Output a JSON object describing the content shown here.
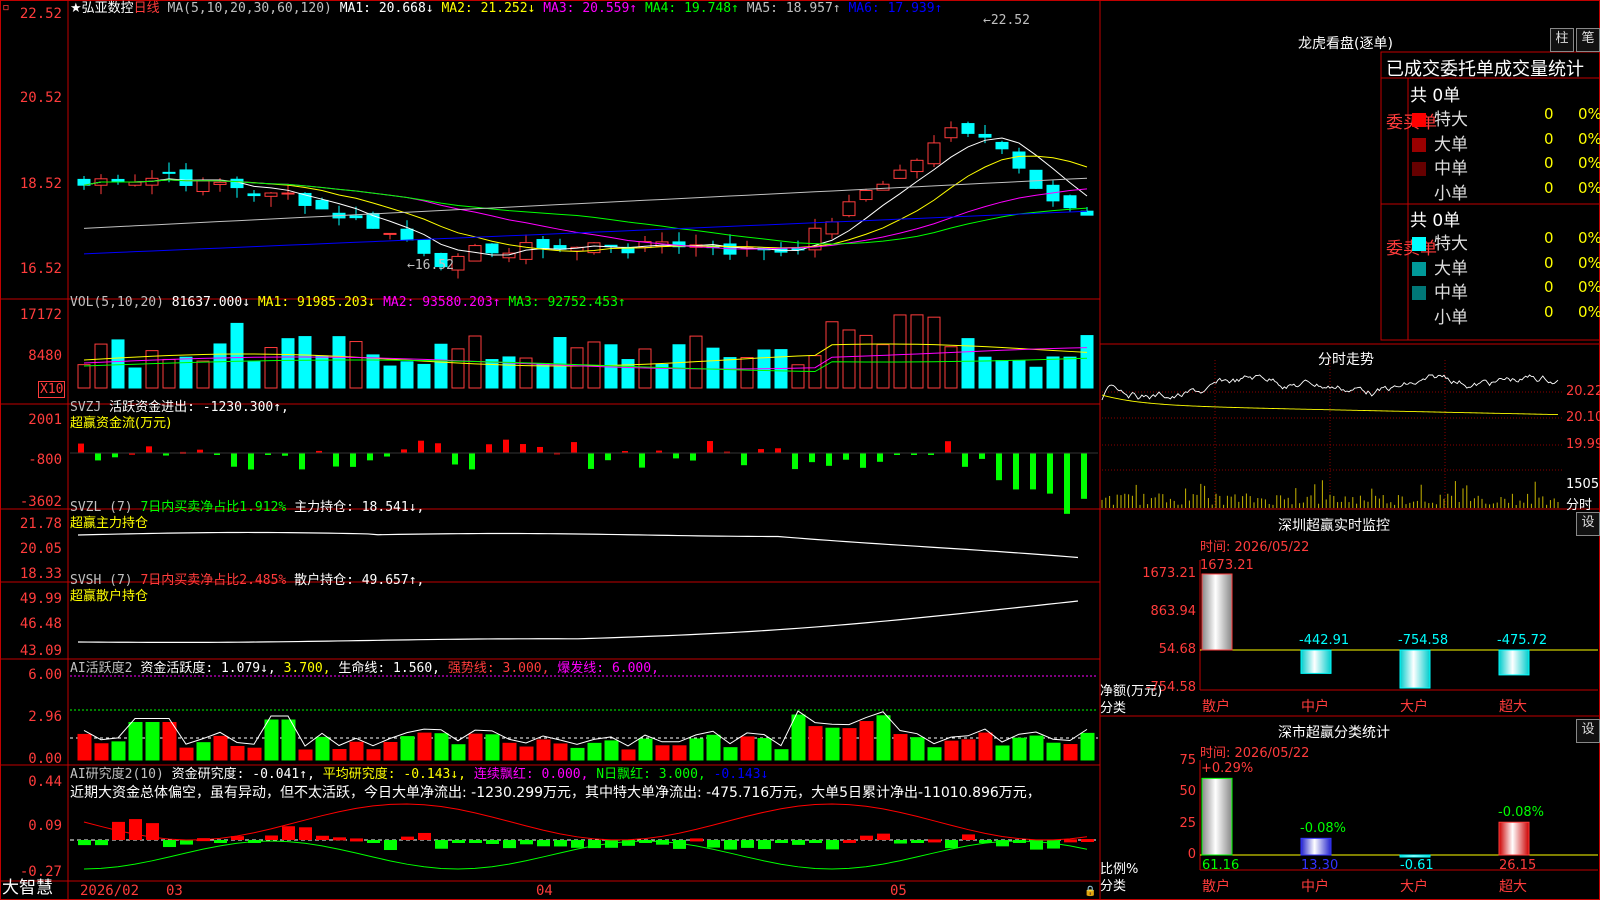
{
  "app": {
    "name": "大智慧"
  },
  "stock": {
    "name": "★弘亚数控",
    "period": "日线"
  },
  "colors": {
    "up": "#ff3c3c",
    "down": "#00ffff",
    "bg": "#000000",
    "frame": "#c00000"
  },
  "main_chart": {
    "ma_text": "MA(5,10,20,30,60,120)",
    "ma": [
      {
        "label": "MA1: 20.668↓",
        "color": "#ffffff"
      },
      {
        "label": "MA2: 21.252↓",
        "color": "#ffff00"
      },
      {
        "label": "MA3: 20.559↑",
        "color": "#ff00ff"
      },
      {
        "label": "MA4: 19.748↑",
        "color": "#00ff00"
      },
      {
        "label": "MA5: 18.957↑",
        "color": "#c0c0c0"
      },
      {
        "label": "MA6: 17.939↑",
        "color": "#0000ff"
      }
    ],
    "y_ticks": [
      "22.52",
      "20.52",
      "18.52",
      "16.52"
    ],
    "high_marker": "22.52",
    "low_marker": "16.52"
  },
  "vol_panel": {
    "title": "VOL(5,10,20)",
    "value": "81637.000↓",
    "ma": [
      {
        "label": "MA1: 91985.203↓",
        "color": "#ffff00"
      },
      {
        "label": "MA2: 93580.203↑",
        "color": "#ff00ff"
      },
      {
        "label": "MA3: 92752.453↑",
        "color": "#00ff00"
      }
    ],
    "y_ticks": [
      "17172",
      "8480"
    ],
    "unit": "X10"
  },
  "svzj_panel": {
    "title": "SVZJ",
    "line1": "活跃资金进出: -1230.300↑,",
    "line2": "超赢资金流(万元)",
    "y_ticks": [
      "2001",
      "-800",
      "-3602"
    ]
  },
  "svzl_panel": {
    "title": "SVZL (7)",
    "line1a": "7日内买卖净占比1.912%",
    "line1b": "主力持仓: 18.541↓,",
    "line2": "超赢主力持仓",
    "y_ticks": [
      "21.78",
      "20.05",
      "18.33"
    ]
  },
  "svsh_panel": {
    "title": "SVSH (7)",
    "line1a": "7日内买卖净占比2.485%",
    "line1b": "散户持仓: 49.657↑,",
    "line2": "超赢散户持仓",
    "y_ticks": [
      "49.99",
      "46.48",
      "43.09"
    ]
  },
  "ai_activity_panel": {
    "title": "AI活跃度2",
    "t1": "资金活跃度: 1.079↓,",
    "t2": "3.700,",
    "t3": "生命线: 1.560,",
    "t4": "强势线: 3.000,",
    "t5": "爆发线: 6.000,",
    "y_ticks": [
      "6.00",
      "2.96",
      "0.00"
    ]
  },
  "ai_research_panel": {
    "title": "AI研究度2(10)",
    "t1": "资金研究度: -0.041↑,",
    "t2": "平均研究度: -0.143↓,",
    "t3": "连续飘红: 0.000,",
    "t4": "N日飘红: 3.000,",
    "t5": "-0.143↓",
    "comment": "近期大资金总体偏空，虽有异动，但不太活跃，今日大单净流出: -1230.299万元，其中特大单净流出: -475.716万元，大单5日累计净出-11010.896万元，",
    "y_ticks": [
      "0.44",
      "0.09",
      "-0.27"
    ]
  },
  "x_axis": {
    "labels": [
      "2026/02",
      "03",
      "04",
      "05"
    ]
  },
  "right_panel": {
    "tiger": {
      "title": "龙虎看盘(逐单)",
      "btn1": "柱",
      "btn2": "笔",
      "header": "已成交委托单成交量统计",
      "buy_label": "委买单",
      "buy_total": "共 0单",
      "sell_label": "委卖单",
      "sell_total": "共 0单",
      "buy_rows": [
        {
          "name": "特大",
          "count": "0",
          "pct": "0%",
          "color": "#ff0000"
        },
        {
          "name": "大单",
          "count": "0",
          "pct": "0%",
          "color": "#990000"
        },
        {
          "name": "中单",
          "count": "0",
          "pct": "0%",
          "color": "#660000"
        },
        {
          "name": "小单",
          "count": "0",
          "pct": "0%",
          "color": "#000000"
        }
      ],
      "sell_rows": [
        {
          "name": "特大",
          "count": "0",
          "pct": "0%",
          "color": "#00ffff"
        },
        {
          "name": "大单",
          "count": "0",
          "pct": "0%",
          "color": "#009999"
        },
        {
          "name": "中单",
          "count": "0",
          "pct": "0%",
          "color": "#007777"
        },
        {
          "name": "小单",
          "count": "0",
          "pct": "0%",
          "color": "#000000"
        }
      ]
    },
    "intraday": {
      "title": "分时走势",
      "y_ticks": [
        "20.22",
        "20.10",
        "19.99"
      ],
      "vol_tick": "1505",
      "vol_unit": "分时"
    },
    "sz_monitor": {
      "title": "深圳超赢实时监控",
      "btn": "设",
      "time": "时间: 2026/05/22",
      "y_ticks": [
        "1673.21",
        "863.94",
        "54.68",
        "-754.58"
      ],
      "y_label": "净额(万元)",
      "x_label": "分类",
      "bars": [
        {
          "name": "散户",
          "value": 1673.21,
          "label": "1673.21"
        },
        {
          "name": "中户",
          "value": -442.91,
          "label": "-442.91"
        },
        {
          "name": "大户",
          "value": -754.58,
          "label": "-754.58"
        },
        {
          "name": "超大",
          "value": -475.72,
          "label": "-475.72"
        }
      ]
    },
    "sz_classify": {
      "title": "深市超赢分类统计",
      "btn": "设",
      "time": "时间: 2026/05/22",
      "y_ticks": [
        "75",
        "50",
        "25",
        "0"
      ],
      "y_label": "比例%",
      "x_label": "分类",
      "bars": [
        {
          "name": "散户",
          "pct": 61.16,
          "top_label": "+0.29%",
          "bottom_label": "61.16"
        },
        {
          "name": "中户",
          "pct": 13.3,
          "top_label": "-0.08%",
          "bottom_label": "13.30"
        },
        {
          "name": "大户",
          "pct": -0.61,
          "top_label": "",
          "bottom_label": "-0.61"
        },
        {
          "name": "超大",
          "pct": 26.15,
          "top_label": "-0.08%",
          "bottom_label": "26.15"
        }
      ]
    }
  }
}
